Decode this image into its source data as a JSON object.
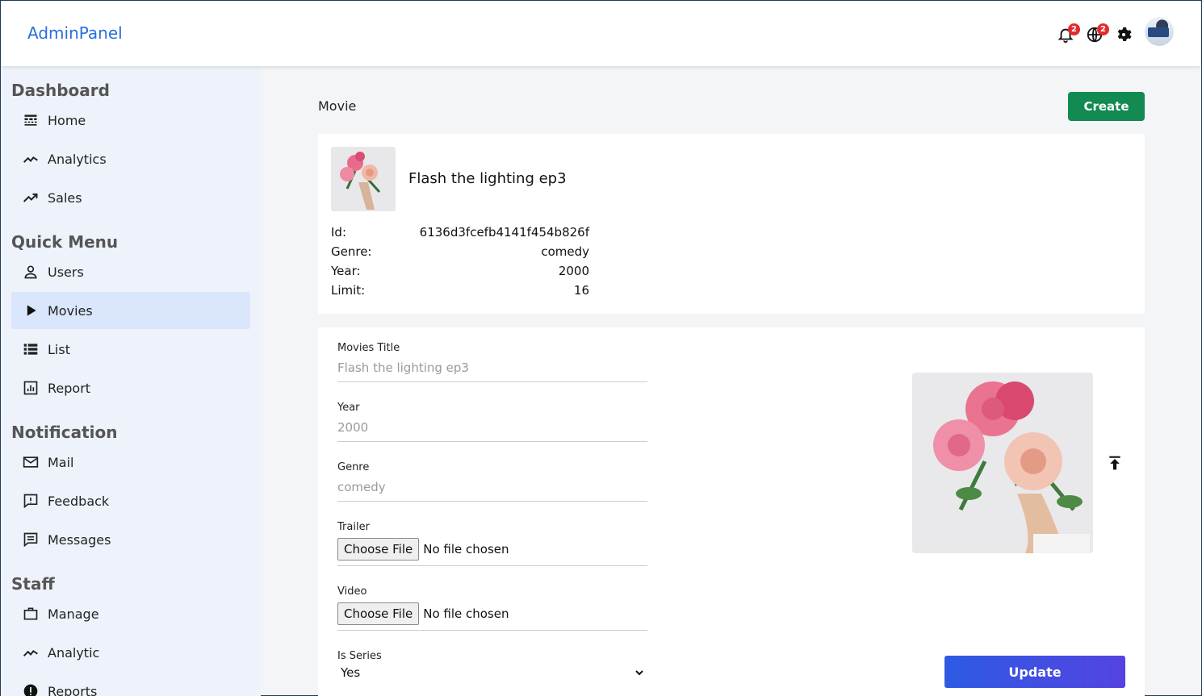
{
  "app": {
    "logo": "AdminPanel"
  },
  "topbar": {
    "notifications_badge": "2",
    "language_badge": "2",
    "icons": [
      "bell-icon",
      "globe-icon",
      "gear-icon",
      "avatar"
    ]
  },
  "sidebar": {
    "sections": [
      {
        "title": "Dashboard",
        "items": [
          {
            "label": "Home",
            "icon": "home-icon"
          },
          {
            "label": "Analytics",
            "icon": "line-chart-icon"
          },
          {
            "label": "Sales",
            "icon": "trending-up-icon"
          }
        ]
      },
      {
        "title": "Quick Menu",
        "items": [
          {
            "label": "Users",
            "icon": "user-icon"
          },
          {
            "label": "Movies",
            "icon": "play-icon",
            "active": true
          },
          {
            "label": "List",
            "icon": "list-icon"
          },
          {
            "label": "Report",
            "icon": "bar-chart-icon"
          }
        ]
      },
      {
        "title": "Notification",
        "items": [
          {
            "label": "Mail",
            "icon": "mail-icon"
          },
          {
            "label": "Feedback",
            "icon": "feedback-icon"
          },
          {
            "label": "Messages",
            "icon": "messages-icon"
          }
        ]
      },
      {
        "title": "Staff",
        "items": [
          {
            "label": "Manage",
            "icon": "briefcase-icon"
          },
          {
            "label": "Analytic",
            "icon": "line-chart-icon"
          },
          {
            "label": "Reports",
            "icon": "alert-icon"
          }
        ]
      }
    ]
  },
  "main": {
    "title": "Movie",
    "create_label": "Create",
    "movie": {
      "name": "Flash the lighting ep3",
      "fields": [
        {
          "key": "Id:",
          "value": "6136d3fcefb4141f454b826f"
        },
        {
          "key": "Genre:",
          "value": "comedy"
        },
        {
          "key": "Year:",
          "value": "2000"
        },
        {
          "key": "Limit:",
          "value": "16"
        }
      ]
    },
    "form": {
      "title_label": "Movies Title",
      "title_placeholder": "Flash the lighting ep3",
      "year_label": "Year",
      "year_placeholder": "2000",
      "genre_label": "Genre",
      "genre_placeholder": "comedy",
      "trailer_label": "Trailer",
      "video_label": "Video",
      "choose_file": "Choose File",
      "no_file": "No file chosen",
      "series_label": "Is Series",
      "series_value": "Yes",
      "update_label": "Update"
    }
  },
  "colors": {
    "brand": "#2a6fdb",
    "create": "#128a52",
    "update_from": "#2d5be3",
    "update_to": "#5443e0",
    "sidebar_bg": "#eef3fb",
    "active_bg": "#d9e6fb",
    "badge": "#e12b2b"
  }
}
